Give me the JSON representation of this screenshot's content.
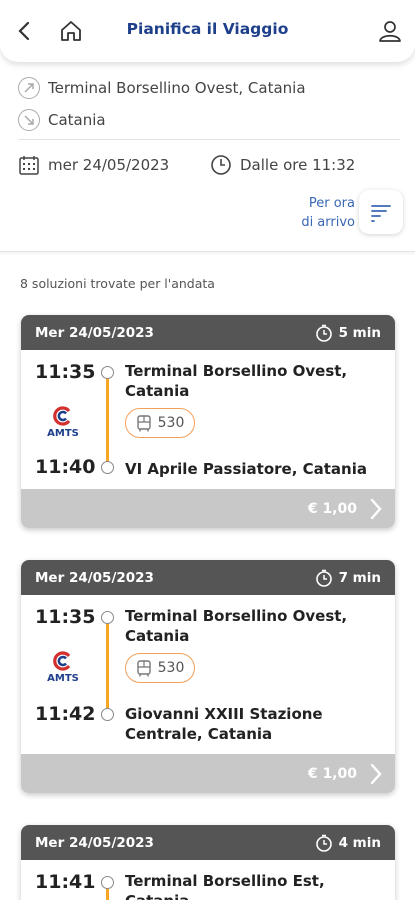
{
  "header": {
    "title": "Pianifica il Viaggio"
  },
  "search": {
    "from": "Terminal Borsellino Ovest, Catania",
    "to": "Catania",
    "date": "mer 24/05/2023",
    "time": "Dalle ore 11:32",
    "sort_line1": "Per ora",
    "sort_line2": "di arrivo"
  },
  "results_count": "8 soluzioni trovate per l'andata",
  "colors": {
    "brand": "#1e3f8a",
    "line": "#f5a623",
    "pill_border": "#f5a05a",
    "card_header": "#555555",
    "card_footer": "#c8c8c8"
  },
  "cards": [
    {
      "date": "Mer 24/05/2023",
      "duration": "5 min",
      "dep_time": "11:35",
      "dep_stop_1": "Terminal Borsellino Ovest,",
      "dep_stop_2": "Catania",
      "line": "530",
      "arr_time": "11:40",
      "arr_stop_1": "VI Aprile Passiatore, Catania",
      "arr_stop_2": "",
      "operator": "AMTS",
      "price": "€ 1,00"
    },
    {
      "date": "Mer 24/05/2023",
      "duration": "7 min",
      "dep_time": "11:35",
      "dep_stop_1": "Terminal Borsellino Ovest,",
      "dep_stop_2": "Catania",
      "line": "530",
      "arr_time": "11:42",
      "arr_stop_1": "Giovanni XXIII Stazione",
      "arr_stop_2": "Centrale, Catania",
      "operator": "AMTS",
      "price": "€ 1,00"
    },
    {
      "date": "Mer 24/05/2023",
      "duration": "4 min",
      "dep_time": "11:41",
      "dep_stop_1": "Terminal Borsellino Est, Catania"
    }
  ]
}
